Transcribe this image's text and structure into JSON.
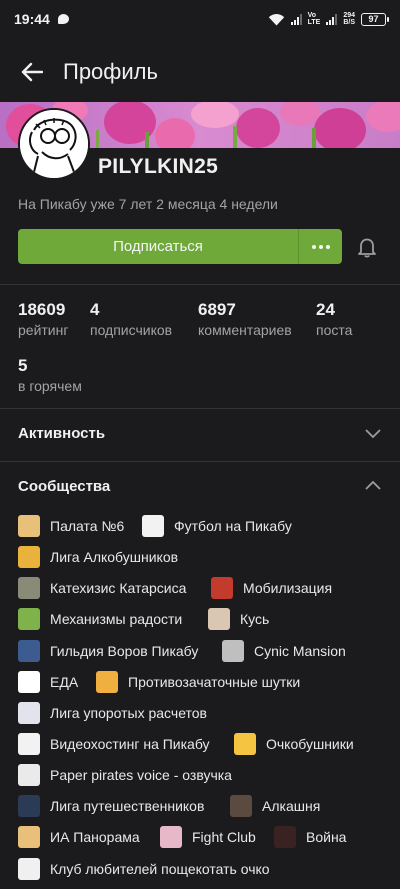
{
  "status_bar": {
    "time": "19:44",
    "network_label_top": "Vo",
    "network_label_bottom": "LTE",
    "speed_value": "294",
    "speed_unit": "B/S",
    "battery": "97"
  },
  "app_bar": {
    "back_icon": "arrow-left-icon",
    "title": "Профиль"
  },
  "profile": {
    "username": "PILYLKIN25",
    "since": "На Пикабу уже 7 лет 2 месяца 4 недели",
    "subscribe_label": "Подписаться",
    "more_icon": "more-dots-icon",
    "bell_icon": "bell-icon"
  },
  "stats": [
    {
      "value": "18609",
      "label": "рейтинг"
    },
    {
      "value": "4",
      "label": "подписчиков"
    },
    {
      "value": "6897",
      "label": "комментариев"
    },
    {
      "value": "24",
      "label": "поста"
    },
    {
      "value": "5",
      "label": "в горячем"
    }
  ],
  "sections": {
    "activity": {
      "title": "Активность",
      "state": "collapsed"
    },
    "communities": {
      "title": "Сообщества",
      "state": "expanded"
    }
  },
  "communities": [
    {
      "name": "Палата №6",
      "color": "#e8c07a"
    },
    {
      "name": "Футбол на Пикабу",
      "color": "#f2f2f2"
    },
    {
      "name": "Лига Алкобушников",
      "color": "#e9b23c"
    },
    {
      "name": "Катехизис Катарсиса",
      "color": "#8a8a78"
    },
    {
      "name": "Мобилизация",
      "color": "#c23b2d"
    },
    {
      "name": "Механизмы радости",
      "color": "#7fb24a"
    },
    {
      "name": "Кусь",
      "color": "#d9c7b4"
    },
    {
      "name": "Гильдия Воров Пикабу",
      "color": "#3c5b8f"
    },
    {
      "name": "Cynic Mansion",
      "color": "#bfbfbf"
    },
    {
      "name": "ЕДА",
      "color": "#ffffff"
    },
    {
      "name": "Противозачаточные шутки",
      "color": "#f0b040"
    },
    {
      "name": "Лига упоротых расчетов",
      "color": "#e3e3ee"
    },
    {
      "name": "Видеохостинг на Пикабу",
      "color": "#f2f2f2"
    },
    {
      "name": "Очкобушники",
      "color": "#f5c542"
    },
    {
      "name": "Paper pirates voice - озвучка",
      "color": "#eaeaea"
    },
    {
      "name": "Лига путешественников",
      "color": "#2b3a55"
    },
    {
      "name": "Алкашня",
      "color": "#5a4a40"
    },
    {
      "name": "ИА Панорама",
      "color": "#e8c07a"
    },
    {
      "name": "Fight Club",
      "color": "#e6b8c8"
    },
    {
      "name": "Война",
      "color": "#3a2222"
    },
    {
      "name": "Клуб любителей пощекотать очко",
      "color": "#f0f0f0"
    }
  ]
}
